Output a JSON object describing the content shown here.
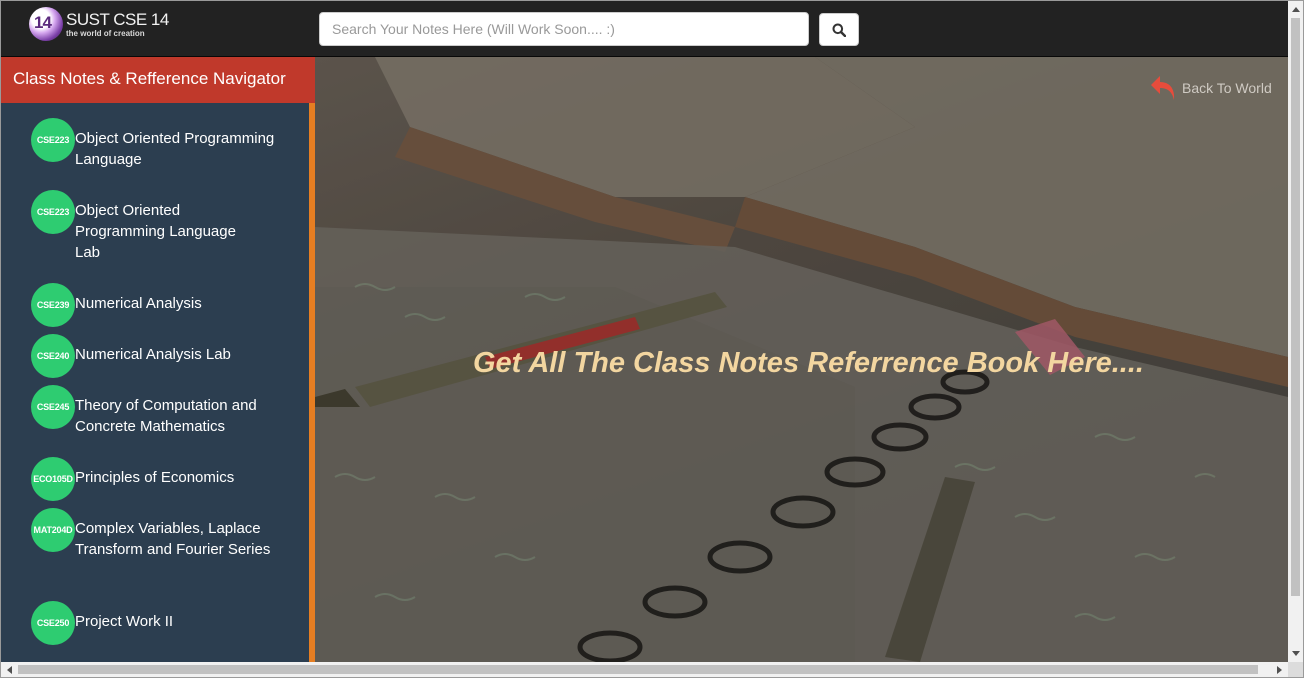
{
  "header": {
    "logo_mark": "14",
    "logo_title": "SUST CSE 14",
    "logo_subtitle": "the world of creation",
    "search_placeholder": "Search Your Notes Here (Will Work Soon.... :)",
    "search_icon": "search-icon"
  },
  "sidebar": {
    "title": "Class Notes & Refference Navigator",
    "courses": [
      {
        "code": "CSE223",
        "name": "Object Oriented Programming Language"
      },
      {
        "code": "CSE223",
        "name": "Object Oriented Programming Language Lab"
      },
      {
        "code": "CSE239",
        "name": "Numerical Analysis"
      },
      {
        "code": "CSE240",
        "name": "Numerical Analysis Lab"
      },
      {
        "code": "CSE245",
        "name": "Theory of Computation and Concrete Mathematics"
      },
      {
        "code": "ECO105D",
        "name": "Principles of Economics"
      },
      {
        "code": "MAT204D",
        "name": "Complex Variables, Laplace Transform and Fourier Series"
      },
      {
        "code": "CSE250",
        "name": "Project Work II"
      }
    ]
  },
  "main": {
    "headline": "Get All The Class Notes Referrence Book Here....",
    "back_link": "Back To World",
    "back_icon": "reply-arrow-icon"
  },
  "colors": {
    "navbar": "#222222",
    "sidebar": "#2c3e50",
    "sidebar_header": "#c0392b",
    "sidebar_accent": "#e67e22",
    "course_badge": "#2ecc71",
    "headline": "#f3d6a0",
    "back_icon": "#e74c3c"
  }
}
